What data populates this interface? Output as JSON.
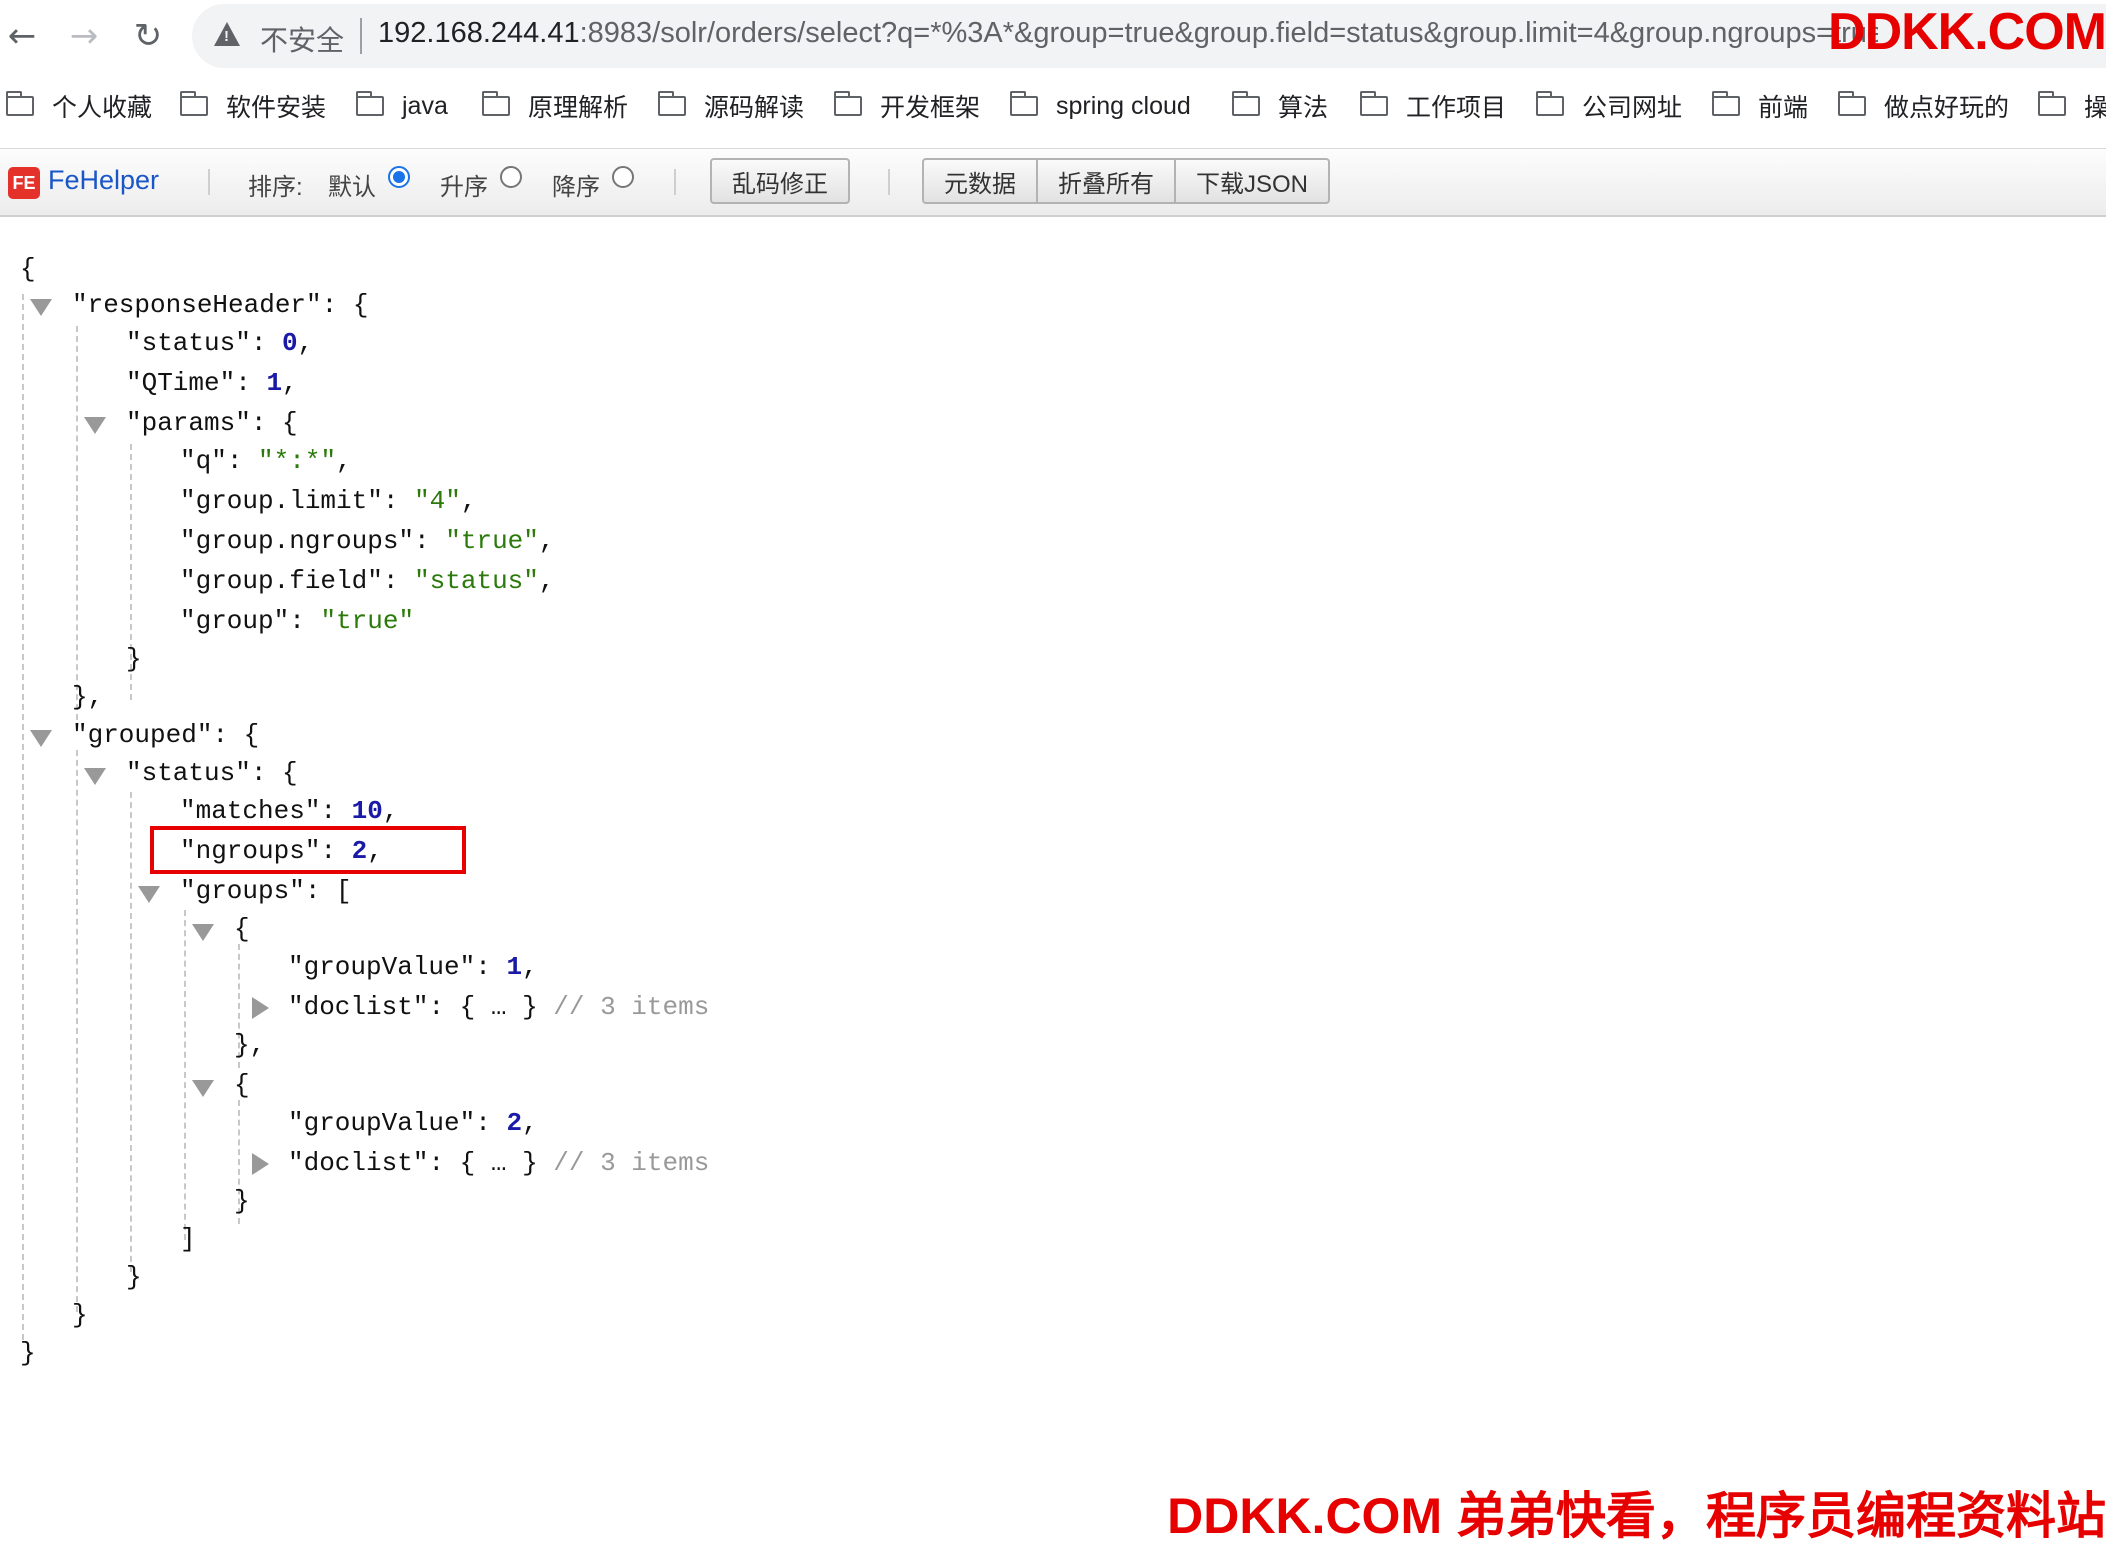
{
  "browser": {
    "address": {
      "security_text": "不安全",
      "url_host": "192.168.244.41",
      "url_rest": ":8983/solr/orders/select?q=*%3A*&group=true&group.field=status&group.limit=4&group.ngroups=true"
    },
    "bookmarks": [
      "个人收藏",
      "软件安装",
      "java",
      "原理解析",
      "源码解读",
      "开发框架",
      "spring cloud",
      "算法",
      "工作项目",
      "公司网址",
      "前端",
      "做点好玩的",
      "操"
    ]
  },
  "fehelper": {
    "logo_text": "FE",
    "name": "FeHelper",
    "sort_label": "排序:",
    "sort_default": "默认",
    "sort_asc": "升序",
    "sort_desc": "降序",
    "selected_sort": "默认",
    "fix_encoding": "乱码修正",
    "metadata": "元数据",
    "collapse_all": "折叠所有",
    "download_json": "下载JSON"
  },
  "json": {
    "open_root": "{",
    "response_header_key": "\"responseHeader\"",
    "status_key": "\"status\"",
    "status_value": "0",
    "qtime_key": "\"QTime\"",
    "qtime_value": "1",
    "params_key": "\"params\"",
    "q_key": "\"q\"",
    "q_value": "\"*:*\"",
    "group_limit_key": "\"group.limit\"",
    "group_limit_value": "\"4\"",
    "group_ngroups_key": "\"group.ngroups\"",
    "group_ngroups_value": "\"true\"",
    "group_field_key": "\"group.field\"",
    "group_field_value": "\"status\"",
    "group_key": "\"group\"",
    "group_value": "\"true\"",
    "grouped_key": "\"grouped\"",
    "grouped_status_key": "\"status\"",
    "matches_key": "\"matches\"",
    "matches_value": "10",
    "ngroups_key": "\"ngroups\"",
    "ngroups_value": "2",
    "groups_key": "\"groups\"",
    "group1_groupvalue_key": "\"groupValue\"",
    "group1_groupvalue_value": "1",
    "group1_doclist_key": "\"doclist\"",
    "group1_doclist_collapsed": "{ … }",
    "group1_doclist_comment": "// 3 items",
    "group2_groupvalue_key": "\"groupValue\"",
    "group2_groupvalue_value": "2",
    "group2_doclist_key": "\"doclist\"",
    "group2_doclist_collapsed": "{ … }",
    "group2_doclist_comment": "// 3 items"
  },
  "watermarks": {
    "top": "DDKK.COM",
    "bottom": "DDKK.COM 弟弟快看，程序员编程资料站"
  },
  "colors": {
    "number": "#1a1aa6",
    "string": "#2b7a0b",
    "comment": "#999999",
    "highlight": "#e60000"
  }
}
